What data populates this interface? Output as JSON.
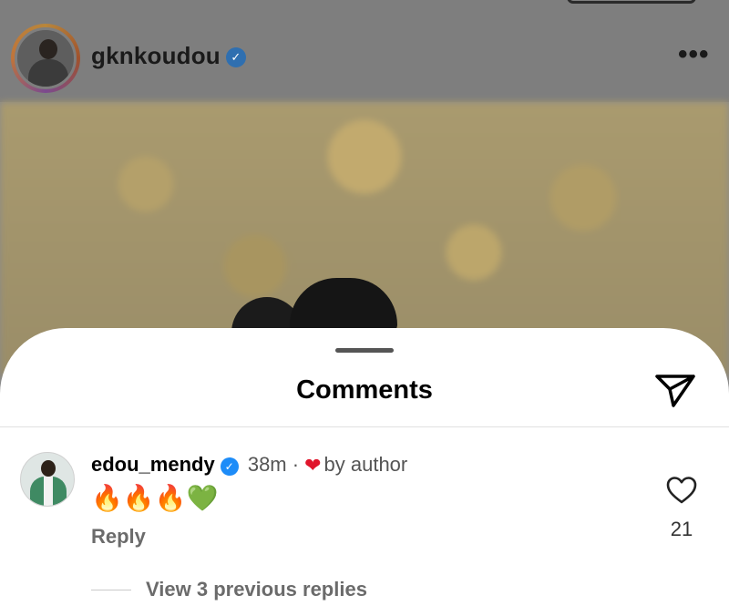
{
  "post": {
    "username": "gknkoudou",
    "verified_glyph": "✓",
    "more_glyph": "•••"
  },
  "sheet": {
    "title": "Comments"
  },
  "comment": {
    "username": "edou_mendy",
    "verified_glyph": "✓",
    "time": "38m",
    "separator": "·",
    "liked_by_author_heart": "❤",
    "liked_by_author_text": "by author",
    "text": "🔥🔥🔥💚",
    "reply_label": "Reply",
    "like_count": "21",
    "view_replies_label": "View 3 previous replies"
  },
  "icons": {
    "share": "paper-plane-icon",
    "like": "heart-outline-icon",
    "more": "more-horizontal-icon"
  },
  "colors": {
    "verified_blue": "#1d8cf8",
    "author_heart_red": "#e0152b",
    "secondary_text": "#6b6b6b"
  }
}
